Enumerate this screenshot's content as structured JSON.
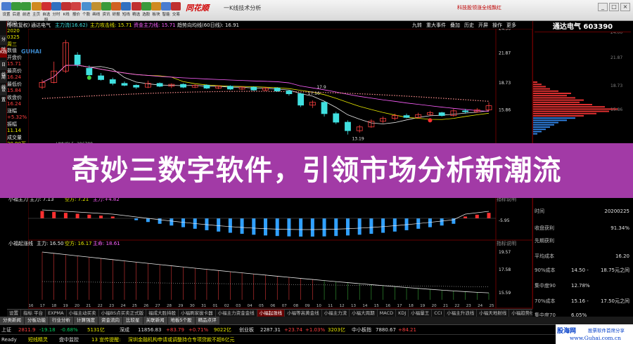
{
  "toolbar": {
    "buttons": [
      {
        "label": "设置",
        "color": "#4a7cd0"
      },
      {
        "label": "后退",
        "color": "#3a9a3a"
      },
      {
        "label": "前进",
        "color": "#3a9a3a"
      },
      {
        "label": "主页",
        "color": "#d08a20"
      },
      {
        "label": "自选股",
        "color": "#d03030"
      },
      {
        "label": "分时",
        "color": "#3070c0"
      },
      {
        "label": "K线",
        "color": "#c03030"
      },
      {
        "label": "报价",
        "color": "#d04040"
      },
      {
        "label": "个股",
        "color": "#4a90d0"
      },
      {
        "label": "画线",
        "color": "#c09030"
      },
      {
        "label": "资讯",
        "color": "#3a9a3a"
      },
      {
        "label": "研报",
        "color": "#d06020"
      },
      {
        "label": "短线",
        "color": "#3070c0"
      },
      {
        "label": "精选",
        "color": "#c03030"
      },
      {
        "label": "选股",
        "color": "#3a9a3a"
      },
      {
        "label": "板块",
        "color": "#d08a20"
      },
      {
        "label": "智能",
        "color": "#4a7cd0"
      },
      {
        "label": "交易",
        "color": "#c03030"
      }
    ],
    "app_logo": "同花顺",
    "window_caption": "一K线技术分析",
    "news_ticker": "科技股领涨全线飘红",
    "win_buttons": [
      "_",
      "□",
      "×"
    ]
  },
  "chart_header": {
    "period": "日线(前复权)",
    "stock": "通达电气",
    "ind1": "主力流(16.62)",
    "ind2": "主力攻击线: 15.71",
    "ind3": "资金主力线: 15.71",
    "ind4": "趋势向均线(60日线): 16.91",
    "ind5": "九转",
    "ind6": "重大事件",
    "ind7": "叠加",
    "ind8": "历史",
    "ind9": "开屏",
    "ind10": "操作",
    "ind11": "更多"
  },
  "left_strip": [
    "分时",
    "K线",
    "日线",
    "周线",
    "设置"
  ],
  "left_panel": {
    "lines": [
      {
        "k": "时间",
        "c": "#e0e0e0"
      },
      {
        "k": "2020",
        "c": "#e8e800"
      },
      {
        "k": "0325",
        "c": "#e8e800"
      },
      {
        "k": "周三",
        "c": "#e8e800"
      },
      {
        "k": "数值",
        "c": "#e0e0e0"
      },
      {
        "k": "开盘价",
        "c": "#e0e0e0"
      },
      {
        "k": "15.71",
        "c": "#ff4040"
      },
      {
        "k": "最高价",
        "c": "#e0e0e0"
      },
      {
        "k": "16.24",
        "c": "#ff4040"
      },
      {
        "k": "最低价",
        "c": "#e0e0e0"
      },
      {
        "k": "15.84",
        "c": "#ff4040"
      },
      {
        "k": "收盘价",
        "c": "#e0e0e0"
      },
      {
        "k": "16.24",
        "c": "#ff4040"
      },
      {
        "k": "涨幅",
        "c": "#e0e0e0"
      },
      {
        "k": "+5.32%",
        "c": "#ff4040"
      },
      {
        "k": "振幅",
        "c": "#e0e0e0"
      },
      {
        "k": "11.14",
        "c": "#e8e800"
      },
      {
        "k": "成交量",
        "c": "#e0e0e0"
      },
      {
        "k": "20.90万",
        "c": "#e8e800"
      },
      {
        "k": "换手率",
        "c": "#e0e0e0"
      }
    ]
  },
  "side_watermark": "GUHAI",
  "price_axis": [
    {
      "v": "24.50",
      "c": "#e0e0e0"
    },
    {
      "v": "21.87",
      "c": "#e0e0e0"
    },
    {
      "v": "18.73",
      "c": "#e0e0e0"
    },
    {
      "v": "15.86",
      "c": "#e0e0e0"
    }
  ],
  "price_annotations": {
    "high": "17.9",
    "low": "13.19",
    "ma": "17.10"
  },
  "vol_header": {
    "label": "VMVOL5: 206788"
  },
  "macd_header": {
    "a": "小福主力 主力: 7.13",
    "b": "空方: 7.21",
    "c": "主力:+4.82"
  },
  "macd_axis": [
    "-5.95"
  ],
  "macd_right_label": "指标说明",
  "bottom_header": {
    "a": "小福起涨线",
    "b": "主力: 16.50",
    "c": "空方: 16.17",
    "d": "主命: 18.61"
  },
  "bottom_axis": [
    "19.57",
    "17.58",
    "15.59"
  ],
  "bottom_right_label": "指标说明",
  "x_axis": [
    "16",
    "17",
    "18",
    "19",
    "20",
    "21",
    "22",
    "23",
    "24",
    "25",
    "26",
    "27",
    "28",
    "29",
    "30",
    "31",
    "01",
    "02",
    "03",
    "04",
    "05",
    "06",
    "07",
    "08",
    "09",
    "10",
    "11",
    "12",
    "13",
    "14",
    "15",
    "16",
    "17",
    "18",
    "19",
    "20",
    "21",
    "22",
    "23",
    "24",
    "25"
  ],
  "stock_title": "通达电气 603390",
  "right_rows": [
    {
      "k": "时间",
      "m": "",
      "v": "20200225",
      "vc": "#e0e0e0"
    },
    {
      "k": "收盘获利",
      "m": "",
      "v": "91.34%",
      "vc": "#e0e0e0"
    },
    {
      "k": "先期获利",
      "m": "",
      "v": "",
      "vc": "#e0e0e0"
    },
    {
      "k": "平均成本",
      "m": "",
      "v": "16.20",
      "vc": "#e0e0e0"
    },
    {
      "k": "90%成本",
      "m": "14.50 -",
      "v": "18.75元之间",
      "vc": "#e0e0e0"
    },
    {
      "k": "集中度90",
      "m": "12.78%",
      "v": "",
      "vc": "#e0e0e0"
    },
    {
      "k": "70%成本",
      "m": "15.16 -",
      "v": "17.50元之间",
      "vc": "#e0e0e0"
    },
    {
      "k": "集中度70",
      "m": "6.05%",
      "v": "",
      "vc": "#e0e0e0"
    }
  ],
  "right_side_prices": [
    "24.00",
    "21.87",
    "18.73",
    "15.86"
  ],
  "banner_text": "奇妙三数字软件，引领市场分析新潮流",
  "indicator_tabs": [
    {
      "label": "设置",
      "active": false
    },
    {
      "label": "指标 平台",
      "active": false
    },
    {
      "label": "EXPMA",
      "active": false
    },
    {
      "label": "小福主动买卖",
      "active": false
    },
    {
      "label": "小福BS点买卖正式版",
      "active": false
    },
    {
      "label": "福成大胜持股",
      "active": false
    },
    {
      "label": "小福刷家拔卡器",
      "active": false
    },
    {
      "label": "小福主力资金金线",
      "active": false
    },
    {
      "label": "小福起涨线",
      "active": true
    },
    {
      "label": "小福等高黄金线",
      "active": false
    },
    {
      "label": "小福主力流",
      "active": false
    },
    {
      "label": "小福大周期",
      "active": false
    },
    {
      "label": "MACD",
      "active": false
    },
    {
      "label": "KDJ",
      "active": false
    },
    {
      "label": "小福量王",
      "active": false
    },
    {
      "label": "CCI",
      "active": false
    },
    {
      "label": "小福主升浪线",
      "active": false
    },
    {
      "label": "小福天地射线",
      "active": false
    },
    {
      "label": "小福趋势线",
      "active": false
    },
    {
      "label": "小福超强线",
      "active": false
    }
  ],
  "section_tabs": [
    "分类新闻",
    "分板功能",
    "行业分析",
    "计算强度",
    "资金流向",
    "比较星",
    "关联新闻",
    "地板5个股",
    "精品点评"
  ],
  "quote_bar": [
    {
      "t": "上证",
      "c": "#e0e0e0"
    },
    {
      "t": "2811.9",
      "c": "#ff4040"
    },
    {
      "t": "-19.18",
      "c": "#00d060"
    },
    {
      "t": "-0.68%",
      "c": "#00d060"
    },
    {
      "t": "5131亿",
      "c": "#e8e800"
    },
    {
      "t": "深成",
      "c": "#e0e0e0"
    },
    {
      "t": "11856.83",
      "c": "#e0e0e0"
    },
    {
      "t": "+83.79",
      "c": "#ff4040"
    },
    {
      "t": "+0.71%",
      "c": "#ff4040"
    },
    {
      "t": "9022亿",
      "c": "#e8e800"
    },
    {
      "t": "创业板",
      "c": "#e0e0e0"
    },
    {
      "t": "2287.31",
      "c": "#e0e0e0"
    },
    {
      "t": "+23.74",
      "c": "#ff4040"
    },
    {
      "t": "+1.03%",
      "c": "#ff4040"
    },
    {
      "t": "3203亿",
      "c": "#e8e800"
    },
    {
      "t": "中小板指",
      "c": "#e0e0e0"
    },
    {
      "t": "7880.67",
      "c": "#e0e0e0"
    },
    {
      "t": "+84.21",
      "c": "#ff4040"
    }
  ],
  "status_bar": [
    {
      "t": "Ready",
      "c": "#e0e0e0"
    },
    {
      "t": "短线精灵",
      "c": "#e8e800"
    },
    {
      "t": "盘中监控",
      "c": "#e0e0e0"
    },
    {
      "t": "13 宣传提醒:",
      "c": "#e8e800"
    },
    {
      "t": "深圳金融机构申请或调整持仓专项贷款不超6亿元",
      "c": "#e8e800"
    }
  ],
  "watermark": {
    "logo": "股海网",
    "slogan": "股票软件首席分享",
    "url": "www.Guhai.com.cn"
  },
  "colors": {
    "up": "#ff4040",
    "down": "#40e0e0",
    "ma1": "#e8e8e8",
    "ma2": "#e8e800",
    "ma3": "#ff60ff",
    "banner": "#a23aa6"
  }
}
